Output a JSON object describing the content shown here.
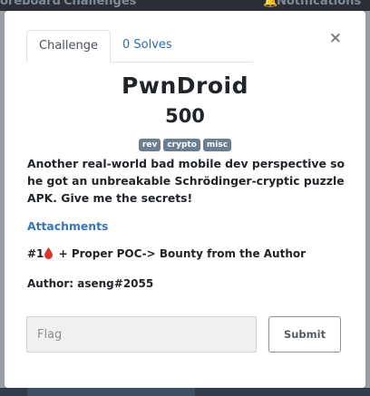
{
  "background_nav": {
    "links": [
      "oreboard",
      "Challenges",
      "Notifications"
    ]
  },
  "modal": {
    "tabs": [
      {
        "label": "Challenge",
        "active": true
      },
      {
        "label": "0 Solves",
        "active": false
      }
    ],
    "close_label": "×",
    "challenge": {
      "name": "PwnDroid",
      "value": "500",
      "tags": [
        "rev",
        "crypto",
        "misc"
      ],
      "description": "Another real-world bad mobile dev perspective so he got an unbreakable Schrödinger-cryptic puzzle APK. Give me the secrets!",
      "attachments_label": "Attachments",
      "bounty_prefix": "#1",
      "bounty_icon": "blood-drop-icon",
      "bounty_text": " + Proper POC-> Bounty from the Author",
      "author": "Author: aseng#2055"
    },
    "flag": {
      "placeholder": "Flag",
      "value": ""
    },
    "submit_label": "Submit"
  },
  "colors": {
    "link": "#3b76b5",
    "tag_bg": "#6b7f92",
    "blood_drop": "#e0312b"
  }
}
